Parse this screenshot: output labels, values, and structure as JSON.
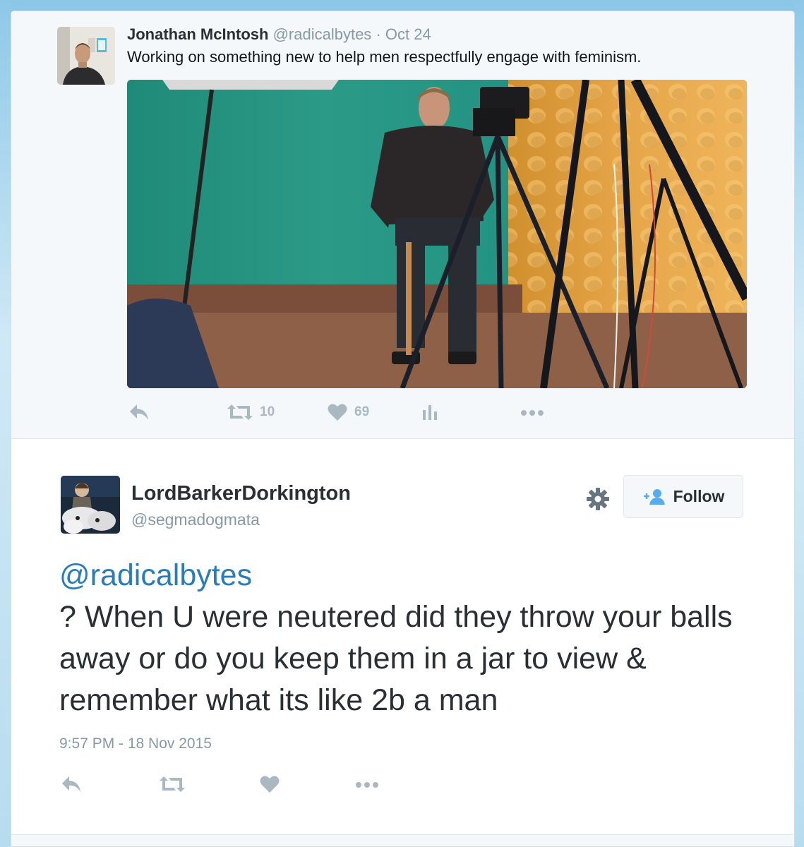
{
  "parent_tweet": {
    "author_name": "Jonathan McIntosh",
    "author_handle": "@radicalbytes",
    "separator": "·",
    "date": "Oct 24",
    "text": "Working on something new to help men respectfully engage with feminism.",
    "retweet_count": "10",
    "like_count": "69",
    "icons": [
      "reply-icon",
      "retweet-icon",
      "heart-icon",
      "analytics-icon",
      "more-icon"
    ]
  },
  "main_tweet": {
    "author_name": "LordBarkerDorkington",
    "author_handle": "@segmadogmata",
    "follow_label": "Follow",
    "mention": "@radicalbytes",
    "text": "? When U were neutered did they throw your balls away or do you keep them in a jar to view & remember what its like 2b a man",
    "timestamp": "9:57 PM - 18 Nov 2015",
    "icons": [
      "gear-icon",
      "follow-person-icon",
      "reply-icon",
      "retweet-icon",
      "heart-icon",
      "more-icon"
    ]
  },
  "colors": {
    "link": "#2b7bb9",
    "muted": "#8899a6",
    "action_icon": "#aab8c2",
    "background": "#a9d6ee"
  }
}
